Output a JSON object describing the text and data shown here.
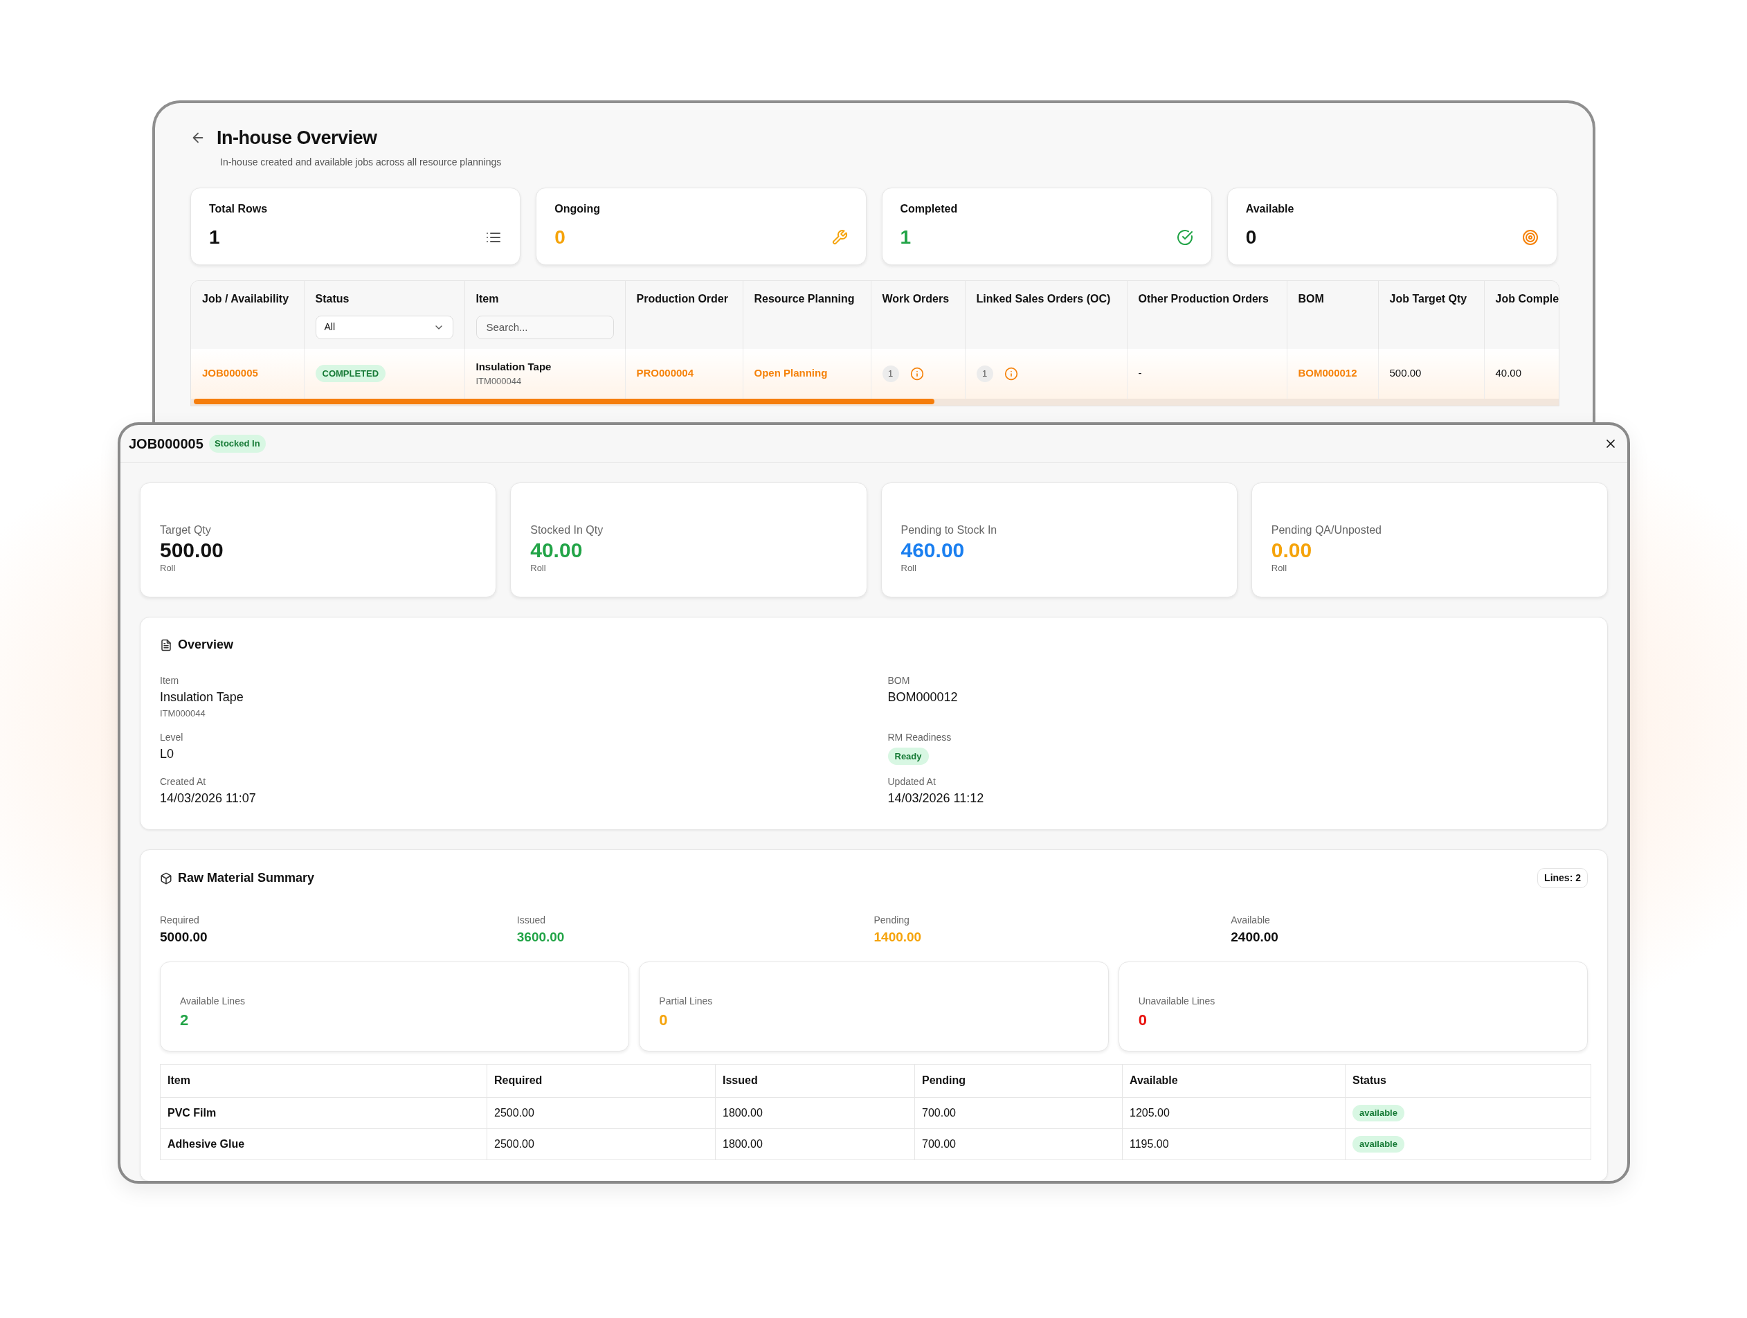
{
  "overview_page": {
    "title": "In-house Overview",
    "subtitle": "In-house created and available jobs across all resource plannings",
    "stat_cards": [
      {
        "label": "Total Rows",
        "value": "1",
        "color": "#111111",
        "kind": "list"
      },
      {
        "label": "Ongoing",
        "value": "0",
        "color": "#f5a30a",
        "kind": "wrench"
      },
      {
        "label": "Completed",
        "value": "1",
        "color": "#22a447",
        "kind": "check"
      },
      {
        "label": "Available",
        "value": "0",
        "color": "#111111",
        "kind": "target"
      }
    ],
    "table": {
      "columns": [
        "Job / Availability",
        "Status",
        "Item",
        "Production Order",
        "Resource Planning",
        "Work Orders",
        "Linked Sales Orders (OC)",
        "Other Production Orders",
        "BOM",
        "Job Target Qty",
        "Job Comple"
      ],
      "status_filter": {
        "value": "All"
      },
      "item_search": {
        "placeholder": "Search..."
      },
      "rows": [
        {
          "cells": [
            {
              "kind": "link",
              "text": "JOB000005"
            },
            {
              "kind": "badge",
              "text": "COMPLETED"
            },
            {
              "kind": "item",
              "text": "Insulation Tape",
              "code": "ITM000044"
            },
            {
              "kind": "link",
              "text": "PRO000004"
            },
            {
              "kind": "link",
              "text": "Open Planning"
            },
            {
              "kind": "count",
              "text": "1"
            },
            {
              "kind": "count",
              "text": "1"
            },
            {
              "kind": "text",
              "text": "-"
            },
            {
              "kind": "link",
              "text": "BOM000012"
            },
            {
              "kind": "text",
              "text": "500.00"
            },
            {
              "kind": "text",
              "text": "40.00"
            }
          ]
        }
      ]
    }
  },
  "job_dialog": {
    "title": "JOB000005",
    "badge": "Stocked In",
    "stat_cards": [
      {
        "label": "Target Qty",
        "value": "500.00",
        "unit": "Roll",
        "color": "#111111"
      },
      {
        "label": "Stocked In Qty",
        "value": "40.00",
        "unit": "Roll",
        "color": "#22a447"
      },
      {
        "label": "Pending to Stock In",
        "value": "460.00",
        "unit": "Roll",
        "color": "#1a7ff0"
      },
      {
        "label": "Pending QA/Unposted",
        "value": "0.00",
        "unit": "Roll",
        "color": "#f5a30a"
      }
    ],
    "overview": {
      "title": "Overview",
      "fields": [
        {
          "kind": "text",
          "label": "Item",
          "value": "Insulation Tape",
          "sub": "ITM000044"
        },
        {
          "kind": "text",
          "label": "BOM",
          "value": "BOM000012"
        },
        {
          "kind": "text",
          "label": "Level",
          "value": "L0"
        },
        {
          "kind": "badge",
          "label": "RM Readiness",
          "value": "Ready"
        },
        {
          "kind": "text",
          "label": "Created At",
          "value": "14/03/2026 11:07"
        },
        {
          "kind": "text",
          "label": "Updated At",
          "value": "14/03/2026 11:12"
        }
      ]
    },
    "raw_material": {
      "title": "Raw Material Summary",
      "lines_badge": "Lines: 2",
      "totals": [
        {
          "label": "Required",
          "value": "5000.00",
          "color": "#111111"
        },
        {
          "label": "Issued",
          "value": "3600.00",
          "color": "#22a447"
        },
        {
          "label": "Pending",
          "value": "1400.00",
          "color": "#f5a30a"
        },
        {
          "label": "Available",
          "value": "2400.00",
          "color": "#111111"
        }
      ],
      "line_cards": [
        {
          "label": "Available Lines",
          "value": "2",
          "color": "#22a447"
        },
        {
          "label": "Partial Lines",
          "value": "0",
          "color": "#f5a30a"
        },
        {
          "label": "Unavailable Lines",
          "value": "0",
          "color": "#e8100c"
        }
      ],
      "table": {
        "columns": [
          "Item",
          "Required",
          "Issued",
          "Pending",
          "Available",
          "Status"
        ],
        "rows": [
          {
            "item": "PVC Film",
            "required": "2500.00",
            "issued": "1800.00",
            "pending": "700.00",
            "available": "1205.00",
            "status": "available"
          },
          {
            "item": "Adhesive Glue",
            "required": "2500.00",
            "issued": "1800.00",
            "pending": "700.00",
            "available": "1195.00",
            "status": "available"
          }
        ]
      }
    }
  }
}
